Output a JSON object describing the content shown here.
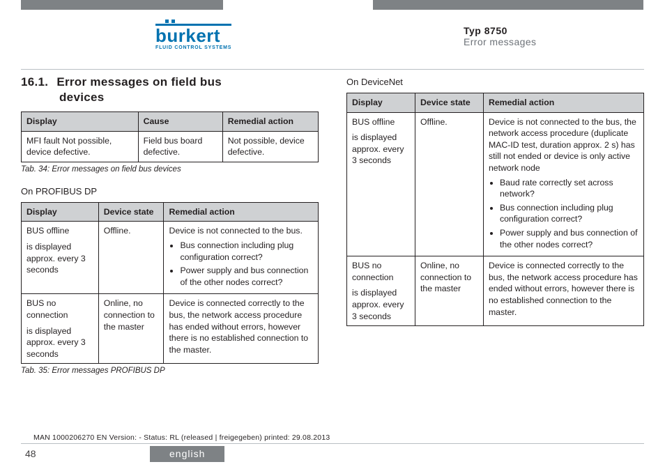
{
  "header": {
    "brand": "burkert",
    "brand_sub": "FLUID CONTROL SYSTEMS",
    "type_label": "Typ 8750",
    "type_sub": "Error messages"
  },
  "section": {
    "number": "16.1.",
    "title_line1": "Error messages on field bus",
    "title_line2": "devices"
  },
  "table1": {
    "headers": [
      "Display",
      "Cause",
      "Remedial action"
    ],
    "rows": [
      {
        "display": "MFI fault Not possible, device defective.",
        "cause": "Field bus board defective.",
        "action": "Not possible, device defective."
      }
    ],
    "caption": "Tab. 34:   Error messages on field bus devices"
  },
  "profibus": {
    "heading": "On PROFIBUS DP",
    "headers": [
      "Display",
      "Device state",
      "Remedial action"
    ],
    "rows": [
      {
        "display_lead": "BUS offline",
        "display_rest": "is displayed approx. every 3 seconds",
        "state": "Offline.",
        "action_intro": "Device is not connected to the bus.",
        "action_list": [
          "Bus connection including plug configuration correct?",
          "Power supply and bus connection of the other nodes correct?"
        ]
      },
      {
        "display_lead": "BUS no connection",
        "display_rest": "is displayed approx. every 3 seconds",
        "state": "Online, no connection to the master",
        "action_intro": "Device is connected correctly to the bus, the network access procedure has ended without errors, however there is no established connection to the master.",
        "action_list": []
      }
    ],
    "caption": "Tab. 35:   Error messages PROFIBUS DP"
  },
  "devicenet": {
    "heading": "On DeviceNet",
    "headers": [
      "Display",
      "Device state",
      "Remedial action"
    ],
    "rows": [
      {
        "display_lead": "BUS offline",
        "display_rest": "is displayed approx. every 3 seconds",
        "state": "Offline.",
        "action_intro": "Device is not connected to the bus, the network access procedure (duplicate MAC-ID test, duration approx. 2 s) has still not ended or device is only active network node",
        "action_list": [
          "Baud rate correctly set across network?",
          "Bus connection including plug configuration correct?",
          "Power supply and bus connection of the other nodes correct?"
        ]
      },
      {
        "display_lead": "BUS no connection",
        "display_rest": "is displayed approx. every 3 seconds",
        "state": "Online, no connection to the master",
        "action_intro": "Device is connected correctly to the bus, the network access procedure has ended without errors, however there is no established connection to the master.",
        "action_list": []
      }
    ]
  },
  "footer": {
    "print_meta": "MAN 1000206270 EN Version: - Status: RL (released | freigegeben) printed: 29.08.2013",
    "page": "48",
    "language": "english"
  }
}
